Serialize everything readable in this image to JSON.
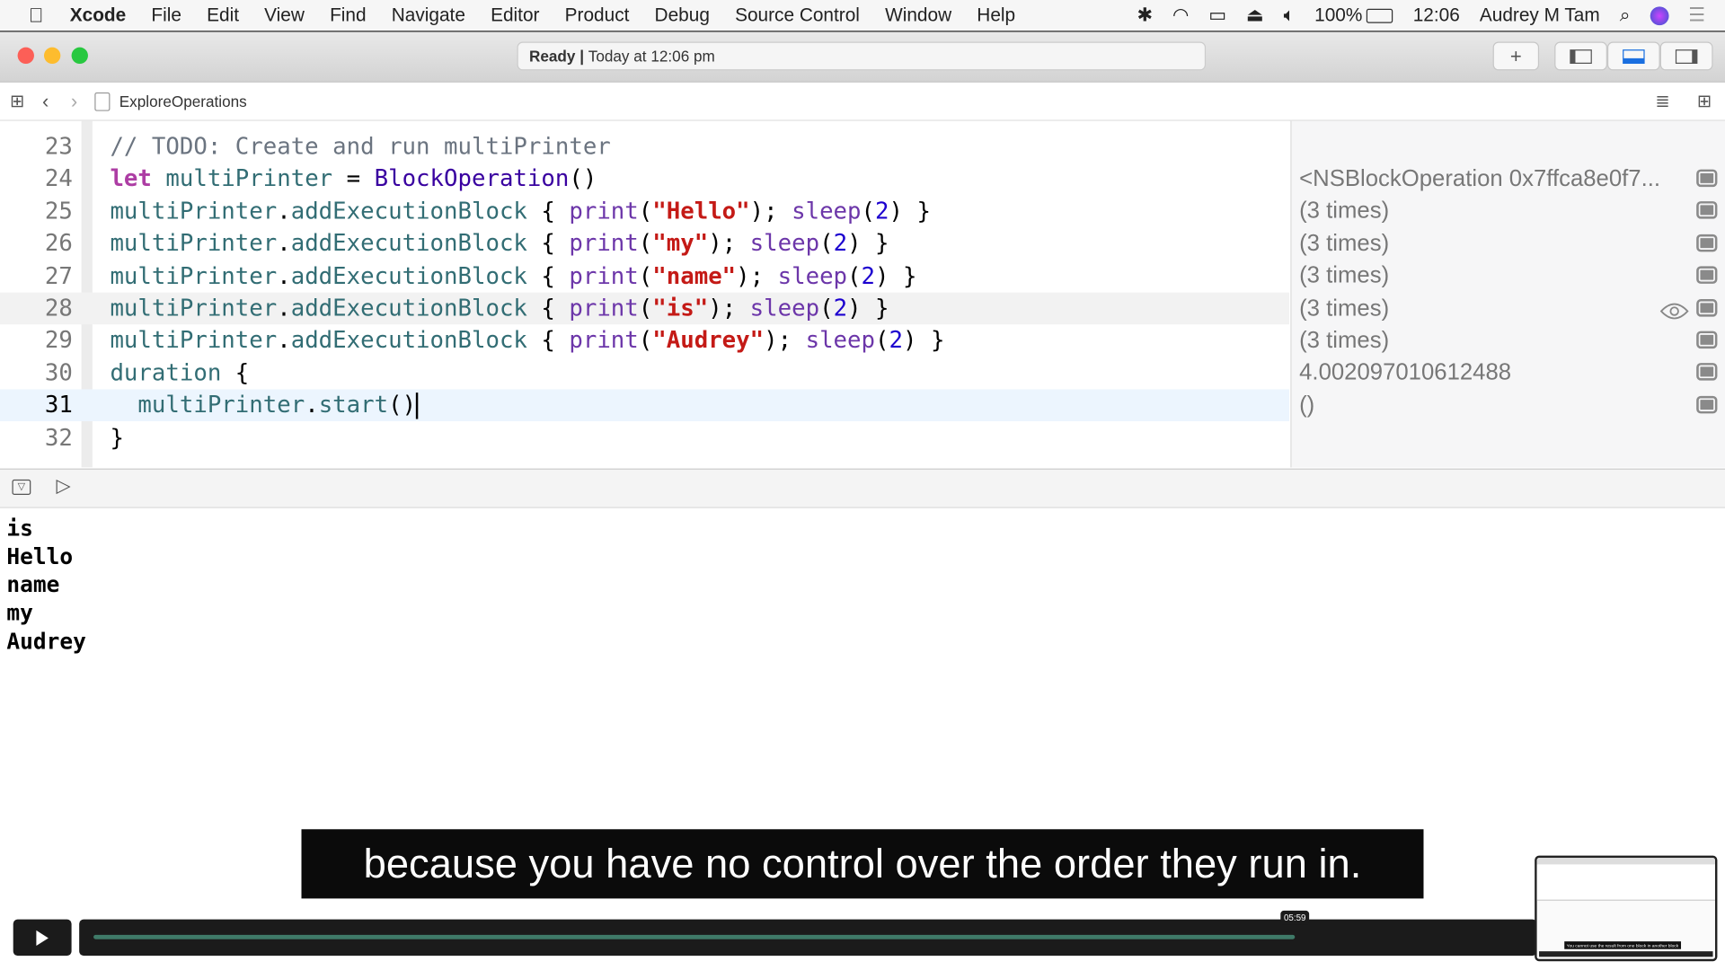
{
  "menubar": {
    "items": [
      "Xcode",
      "File",
      "Edit",
      "View",
      "Find",
      "Navigate",
      "Editor",
      "Product",
      "Debug",
      "Source Control",
      "Window",
      "Help"
    ],
    "battery": "100%",
    "clock": "12:06",
    "user": "Audrey M Tam"
  },
  "toolbar": {
    "status_bold": "Ready |",
    "status_text": "Today at 12:06 pm"
  },
  "jumpbar": {
    "file": "ExploreOperations"
  },
  "editor": {
    "current_line": 31,
    "lines": [
      {
        "n": "23",
        "tokens": [
          {
            "t": "// TODO: Create and run multiPrinter",
            "c": "cm"
          }
        ]
      },
      {
        "n": "24",
        "tokens": [
          {
            "t": "let ",
            "c": "kw"
          },
          {
            "t": "multiPrinter",
            "c": "id"
          },
          {
            "t": " = ",
            "c": "pl"
          },
          {
            "t": "BlockOperation",
            "c": "ty"
          },
          {
            "t": "()",
            "c": "pl"
          }
        ]
      },
      {
        "n": "25",
        "tokens": [
          {
            "t": "multiPrinter",
            "c": "id"
          },
          {
            "t": ".",
            "c": "pl"
          },
          {
            "t": "addExecutionBlock",
            "c": "id"
          },
          {
            "t": " { ",
            "c": "pl"
          },
          {
            "t": "print",
            "c": "fn"
          },
          {
            "t": "(",
            "c": "pl"
          },
          {
            "t": "\"Hello\"",
            "c": "st"
          },
          {
            "t": "); ",
            "c": "pl"
          },
          {
            "t": "sleep",
            "c": "fn"
          },
          {
            "t": "(",
            "c": "pl"
          },
          {
            "t": "2",
            "c": "nu"
          },
          {
            "t": ") }",
            "c": "pl"
          }
        ]
      },
      {
        "n": "26",
        "tokens": [
          {
            "t": "multiPrinter",
            "c": "id"
          },
          {
            "t": ".",
            "c": "pl"
          },
          {
            "t": "addExecutionBlock",
            "c": "id"
          },
          {
            "t": " { ",
            "c": "pl"
          },
          {
            "t": "print",
            "c": "fn"
          },
          {
            "t": "(",
            "c": "pl"
          },
          {
            "t": "\"my\"",
            "c": "st"
          },
          {
            "t": "); ",
            "c": "pl"
          },
          {
            "t": "sleep",
            "c": "fn"
          },
          {
            "t": "(",
            "c": "pl"
          },
          {
            "t": "2",
            "c": "nu"
          },
          {
            "t": ") }",
            "c": "pl"
          }
        ]
      },
      {
        "n": "27",
        "tokens": [
          {
            "t": "multiPrinter",
            "c": "id"
          },
          {
            "t": ".",
            "c": "pl"
          },
          {
            "t": "addExecutionBlock",
            "c": "id"
          },
          {
            "t": " { ",
            "c": "pl"
          },
          {
            "t": "print",
            "c": "fn"
          },
          {
            "t": "(",
            "c": "pl"
          },
          {
            "t": "\"name\"",
            "c": "st"
          },
          {
            "t": "); ",
            "c": "pl"
          },
          {
            "t": "sleep",
            "c": "fn"
          },
          {
            "t": "(",
            "c": "pl"
          },
          {
            "t": "2",
            "c": "nu"
          },
          {
            "t": ") }",
            "c": "pl"
          }
        ]
      },
      {
        "n": "28",
        "tokens": [
          {
            "t": "multiPrinter",
            "c": "id"
          },
          {
            "t": ".",
            "c": "pl"
          },
          {
            "t": "addExecutionBlock",
            "c": "id"
          },
          {
            "t": " { ",
            "c": "pl"
          },
          {
            "t": "print",
            "c": "fn"
          },
          {
            "t": "(",
            "c": "pl"
          },
          {
            "t": "\"is\"",
            "c": "st"
          },
          {
            "t": "); ",
            "c": "pl"
          },
          {
            "t": "sleep",
            "c": "fn"
          },
          {
            "t": "(",
            "c": "pl"
          },
          {
            "t": "2",
            "c": "nu"
          },
          {
            "t": ") }",
            "c": "pl"
          }
        ]
      },
      {
        "n": "29",
        "tokens": [
          {
            "t": "multiPrinter",
            "c": "id"
          },
          {
            "t": ".",
            "c": "pl"
          },
          {
            "t": "addExecutionBlock",
            "c": "id"
          },
          {
            "t": " { ",
            "c": "pl"
          },
          {
            "t": "print",
            "c": "fn"
          },
          {
            "t": "(",
            "c": "pl"
          },
          {
            "t": "\"Audrey\"",
            "c": "st"
          },
          {
            "t": "); ",
            "c": "pl"
          },
          {
            "t": "sleep",
            "c": "fn"
          },
          {
            "t": "(",
            "c": "pl"
          },
          {
            "t": "2",
            "c": "nu"
          },
          {
            "t": ") }",
            "c": "pl"
          }
        ]
      },
      {
        "n": "30",
        "tokens": [
          {
            "t": "duration",
            "c": "id"
          },
          {
            "t": " {",
            "c": "pl"
          }
        ]
      },
      {
        "n": "31",
        "tokens": [
          {
            "t": "  multiPrinter",
            "c": "id"
          },
          {
            "t": ".",
            "c": "pl"
          },
          {
            "t": "start",
            "c": "id"
          },
          {
            "t": "()",
            "c": "pl"
          }
        ]
      },
      {
        "n": "32",
        "tokens": [
          {
            "t": "}",
            "c": "pl"
          }
        ]
      }
    ]
  },
  "results": [
    {
      "line": "24",
      "text": "<NSBlockOperation 0x7ffca8e0f7..."
    },
    {
      "line": "25",
      "text": "(3 times)"
    },
    {
      "line": "26",
      "text": "(3 times)"
    },
    {
      "line": "27",
      "text": "(3 times)"
    },
    {
      "line": "28",
      "text": "(3 times)",
      "eye": true
    },
    {
      "line": "29",
      "text": "(3 times)"
    },
    {
      "line": "30",
      "text": "4.002097010612488"
    },
    {
      "line": "31",
      "text": "()"
    }
  ],
  "console": [
    "is",
    "Hello",
    "name",
    "my",
    "Audrey"
  ],
  "video": {
    "subtitle": "because you have no control over the order they run in.",
    "time": "05:59",
    "progress": 0.84,
    "thumbnail_subtitle": "You cannot use the result from one block in another block"
  }
}
